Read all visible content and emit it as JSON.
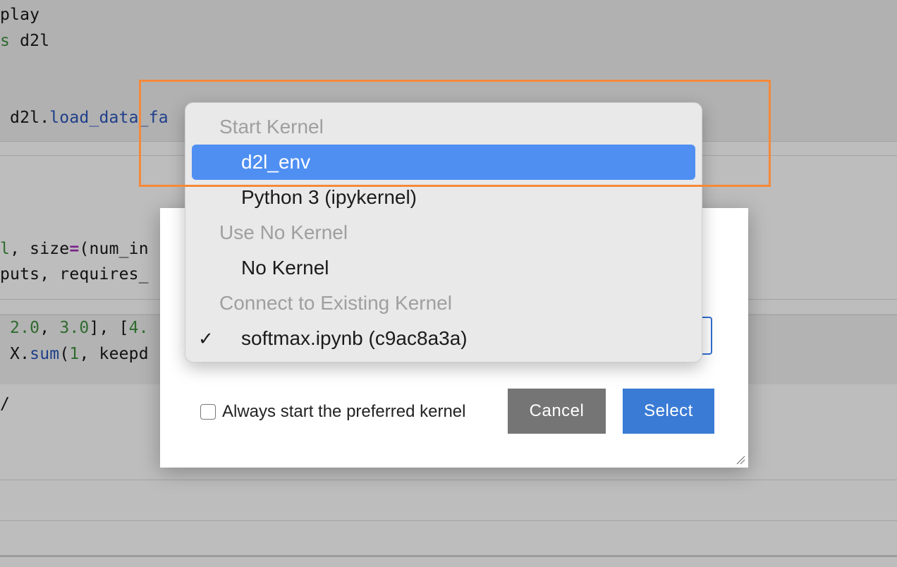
{
  "notebook": {
    "lines": [
      {
        "parts": [
          {
            "t": "play",
            "c": ""
          }
        ]
      },
      {
        "parts": [
          {
            "t": "s",
            "c": "k-green"
          },
          {
            "t": " d2l",
            "c": ""
          }
        ]
      },
      {
        "parts": [
          {
            "t": " d2l.",
            "c": ""
          },
          {
            "t": "load_data_fa",
            "c": "k-blue"
          }
        ]
      },
      {
        "parts": [
          {
            "t": "l",
            "c": "k-green"
          },
          {
            "t": ", size",
            "c": ""
          },
          {
            "t": "=",
            "c": "k-purple"
          },
          {
            "t": "(num_in",
            "c": ""
          }
        ]
      },
      {
        "parts": [
          {
            "t": "puts, requires_",
            "c": ""
          }
        ]
      },
      {
        "parts": [
          {
            "t": " 2.0",
            "c": "k-green"
          },
          {
            "t": ", ",
            "c": ""
          },
          {
            "t": "3.0",
            "c": "k-green"
          },
          {
            "t": "], [",
            "c": ""
          },
          {
            "t": "4.",
            "c": "k-green"
          }
        ]
      },
      {
        "parts": [
          {
            "t": " X.",
            "c": ""
          },
          {
            "t": "sum",
            "c": "k-blue"
          },
          {
            "t": "(",
            "c": ""
          },
          {
            "t": "1",
            "c": "k-green"
          },
          {
            "t": ", keepd",
            "c": ""
          }
        ]
      },
      {
        "parts": [
          {
            "t": "/",
            "c": ""
          }
        ]
      }
    ]
  },
  "kernel_menu": {
    "sections": [
      {
        "type": "header",
        "label": "Start Kernel"
      },
      {
        "type": "item",
        "label": "d2l_env",
        "selected": true
      },
      {
        "type": "item",
        "label": "Python 3 (ipykernel)"
      },
      {
        "type": "header",
        "label": "Use No Kernel"
      },
      {
        "type": "item",
        "label": "No Kernel"
      },
      {
        "type": "header",
        "label": "Connect to Existing Kernel"
      },
      {
        "type": "item",
        "label": "softmax.ipynb (c9ac8a3a)",
        "checked": true
      }
    ],
    "check_glyph": "✓"
  },
  "dialog": {
    "always_start_label": "Always start the preferred kernel",
    "always_start_checked": false,
    "cancel_label": "Cancel",
    "select_label": "Select"
  },
  "colors": {
    "highlight": "#4f8ff2",
    "annotation": "#f5893a",
    "select_button": "#3a7bd5",
    "cancel_button": "#757575"
  }
}
